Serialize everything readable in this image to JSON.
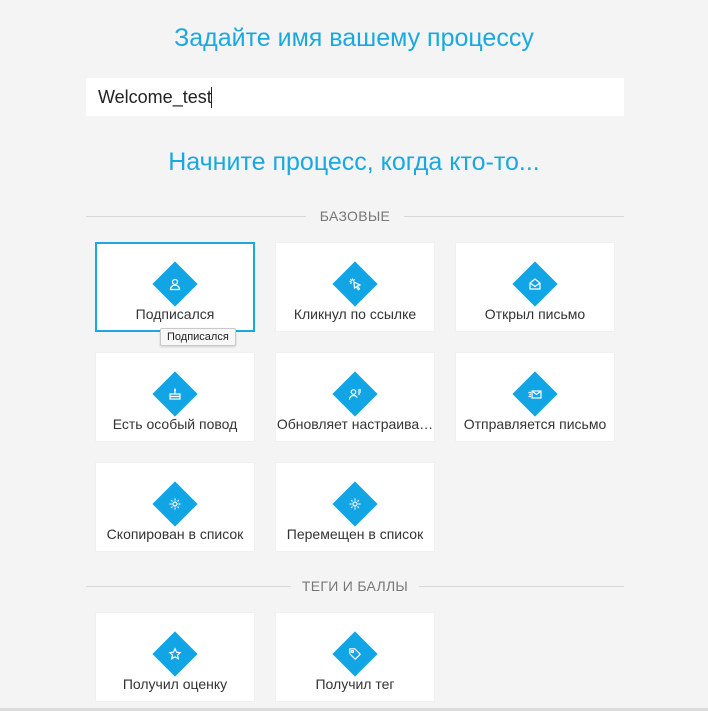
{
  "header": {
    "name_title": "Задайте имя вашему процессу",
    "start_title": "Начните процесс, когда кто-то..."
  },
  "process_name": {
    "value": "Welcome_test"
  },
  "sections": {
    "basic": {
      "label": "БАЗОВЫЕ",
      "items": [
        {
          "label": "Подписался",
          "icon": "user-icon",
          "selected": true
        },
        {
          "label": "Кликнул по ссылке",
          "icon": "cursor-click-icon"
        },
        {
          "label": "Открыл письмо",
          "icon": "open-envelope-icon"
        },
        {
          "label": "Есть особый повод",
          "icon": "cake-icon"
        },
        {
          "label": "Обновляет настраива…",
          "icon": "user-edit-icon"
        },
        {
          "label": "Отправляется письмо",
          "icon": "send-envelope-icon"
        },
        {
          "label": "Скопирован в список",
          "icon": "copy-gear-icon"
        },
        {
          "label": "Перемещен в список",
          "icon": "move-gear-icon"
        }
      ]
    },
    "tags": {
      "label": "ТЕГИ И БАЛЛЫ",
      "items": [
        {
          "label": "Получил оценку",
          "icon": "star-icon"
        },
        {
          "label": "Получил тег",
          "icon": "tag-icon"
        }
      ]
    }
  },
  "tooltip": "Подписался",
  "colors": {
    "accent": "#1aa8e0",
    "diamond": "#12a5e6",
    "background": "#f4f4f4"
  }
}
